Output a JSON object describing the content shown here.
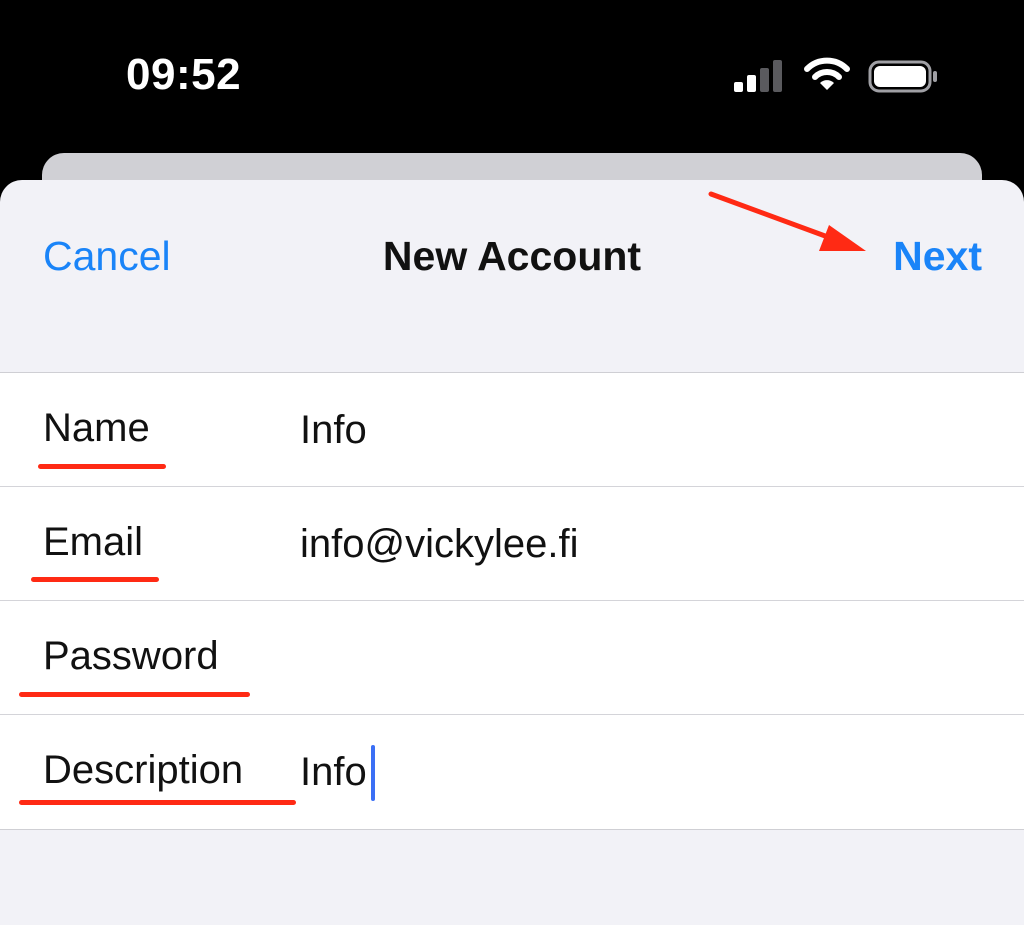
{
  "status_bar": {
    "time": "09:52",
    "icons": [
      "cellular-signal-icon",
      "wifi-icon",
      "battery-icon"
    ]
  },
  "nav": {
    "cancel_label": "Cancel",
    "title": "New Account",
    "next_label": "Next"
  },
  "form": {
    "rows": [
      {
        "label": "Name",
        "value": "Info"
      },
      {
        "label": "Email",
        "value": "info@vickylee.fi"
      },
      {
        "label": "Password",
        "value": ""
      },
      {
        "label": "Description",
        "value": "Info"
      }
    ]
  },
  "colors": {
    "accent": "#1a84f8",
    "annotation": "#ff2a14",
    "sheet_background": "#f2f2f7",
    "status_bar": "#000000",
    "cursor": "#3b6ff5"
  }
}
